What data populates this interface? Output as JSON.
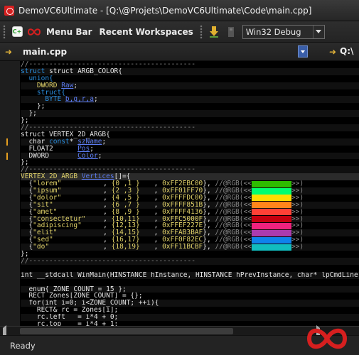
{
  "window": {
    "title": "DemoVC6Ultimate - [Q:\\@Projets\\DemoVC6Ultimate\\Code\\main.cpp]"
  },
  "toolbar": {
    "menu_bar_label": "Menu Bar",
    "recent_workspaces_label": "Recent Workspaces",
    "config_value": "Win32 Debug"
  },
  "file_tab": {
    "name": "main.cpp",
    "path": "Q:\\"
  },
  "status": {
    "text": "Ready"
  },
  "colors": {
    "accent": "#e7a020",
    "brand": "#d61f1f"
  },
  "code": {
    "divider": "//-----------------------------------------",
    "struct_argb_decl": "struct ARGB_COLOR{",
    "union_open": "  union{",
    "dword_raw_type": "    DWORD ",
    "dword_raw_name": "Raw",
    "struct_inner": "    struct{",
    "byte_line_type": "      BYTE ",
    "byte_line_names": "b,g,r,a",
    "inner_close": "    };",
    "union_close": "  };",
    "struct_close": "};",
    "struct_vertex_decl": "struct VERTEX_2D_ARGB{",
    "field1_type": "  char ",
    "field1_kw": "const",
    "field1_ptr": "* ",
    "field1_name": "szName",
    "field2_type": "  FLOAT2      ",
    "field2_name": "Pos",
    "field3_type": "  DWORD       ",
    "field3_name": "Color",
    "vertices_type": "VERTEX_2D_ARGB ",
    "vertices_name": "Vertices",
    "vertices_rest": "[]={",
    "winmain": "int __stdcall WinMain(HINSTANCE hInstance, HINSTANCE hPrevInstance, char* lpCmdLine, int nCmdShow){",
    "enum_line": "  enum{ ZONE_COUNT = 15 };",
    "rect_line": "  RECT Zones[ZONE_COUNT] = {};",
    "for_line": "  for(int i=0; i<ZONE_COUNT; ++i){",
    "rectref_line": "    RECT& rc = Zones[i];",
    "left_line": "    rc.left   = i*4 + 0;",
    "top_line": "    rc.top    = i*4 + 1;"
  },
  "vertices": [
    {
      "name": "\"lorem\"",
      "pos": "{0 ,1 }",
      "hex": "0xFF2EBC00",
      "swatch": "#2ebc00"
    },
    {
      "name": "\"ipsum\"",
      "pos": "{2 ,3 }",
      "hex": "0xFF01FF70",
      "swatch": "#01ff70"
    },
    {
      "name": "\"dolor\"",
      "pos": "{4 ,5 }",
      "hex": "0xFFFFDC00",
      "swatch": "#ffdc00"
    },
    {
      "name": "\"sit\"",
      "pos": "{6 ,7 }",
      "hex": "0xFFFF851B",
      "swatch": "#ff851b"
    },
    {
      "name": "\"amet\"",
      "pos": "{8 ,9 }",
      "hex": "0xFFFF4136",
      "swatch": "#ff4136"
    },
    {
      "name": "\"consectetur\"",
      "pos": "{10,11}",
      "hex": "0xFFC5000F",
      "swatch": "#c5000f"
    },
    {
      "name": "\"adipiscing\"",
      "pos": "{12,13}",
      "hex": "0xFFEF227E",
      "swatch": "#ef227e"
    },
    {
      "name": "\"elit\"",
      "pos": "{14,15}",
      "hex": "0xFFAB3BAF",
      "swatch": "#ab3baf"
    },
    {
      "name": "\"sed\"",
      "pos": "{16,17}",
      "hex": "0xFF0F82EC",
      "swatch": "#0f82ec"
    },
    {
      "name": "\"do\"",
      "pos": "{18,19}",
      "hex": "0xFF11BCBF",
      "swatch": "#11bcbf"
    }
  ],
  "rgb_comment": "//@RGB(<<",
  "rgb_close": ">>)",
  "rgb_close_marker": "}"
}
